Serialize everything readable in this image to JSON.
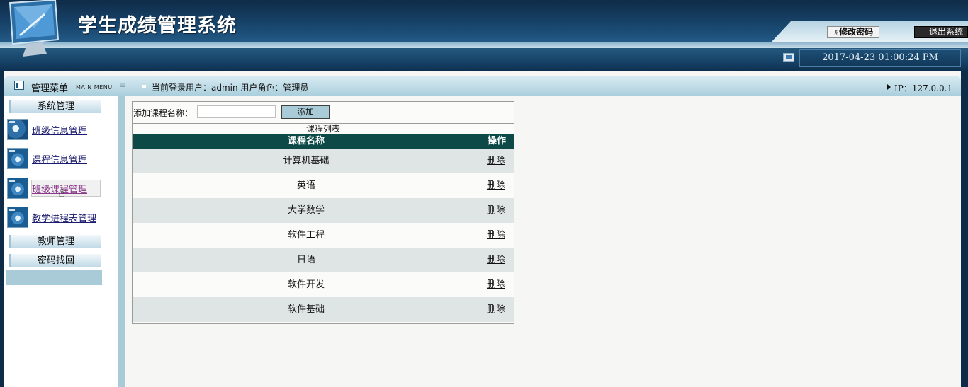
{
  "header": {
    "title": "学生成绩管理系统",
    "change_password": "修改密码",
    "logout": "退出系统",
    "datetime": "2017-04-23 01:00:24 PM"
  },
  "infobar": {
    "menu_title": "管理菜单",
    "menu_subtitle": "MAIN MENU",
    "user_info": "当前登录用户：admin 用户角色：管理员",
    "ip": "IP：127.0.0.1"
  },
  "sidebar": {
    "sections": [
      {
        "label": "系统管理"
      },
      {
        "label": "教师管理"
      },
      {
        "label": "密码找回"
      }
    ],
    "items": [
      {
        "label": "班级信息管理",
        "icon": "users-icon"
      },
      {
        "label": "课程信息管理",
        "icon": "gear-icon"
      },
      {
        "label": "班级课程管理",
        "icon": "gear-icon"
      },
      {
        "label": "教学进程表管理",
        "icon": "gear-icon"
      }
    ]
  },
  "course_form": {
    "label": "添加课程名称：",
    "input_value": "",
    "add_button": "添加"
  },
  "course_table": {
    "title": "课程列表",
    "columns": [
      "课程名称",
      "操作"
    ],
    "rows": [
      {
        "name": "计算机基础",
        "action": "删除"
      },
      {
        "name": "英语",
        "action": "删除"
      },
      {
        "name": "大学数学",
        "action": "删除"
      },
      {
        "name": "软件工程",
        "action": "删除"
      },
      {
        "name": "日语",
        "action": "删除"
      },
      {
        "name": "软件开发",
        "action": "删除"
      },
      {
        "name": "软件基础",
        "action": "删除"
      }
    ]
  },
  "colors": {
    "header_dark": "#0e2c47",
    "table_header": "#0d4a47",
    "accent_light": "#a9cbd8",
    "row_alt": "#dfe5e4"
  }
}
